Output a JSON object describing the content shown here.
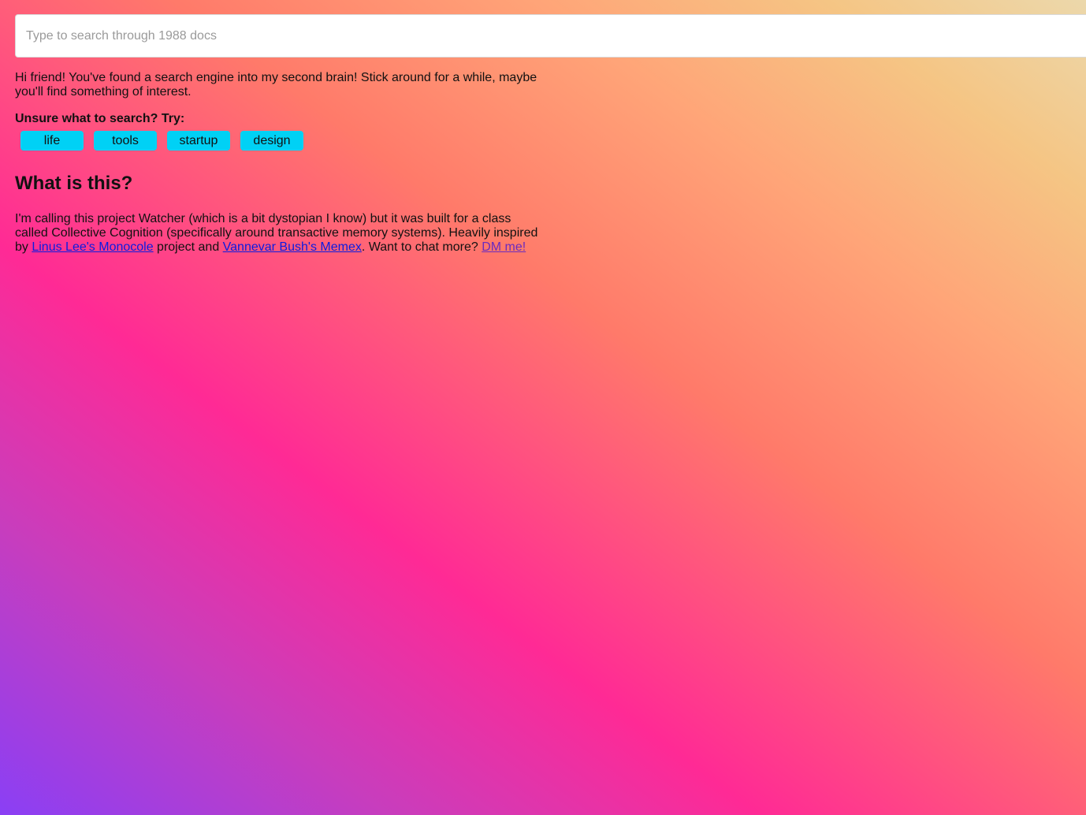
{
  "search": {
    "placeholder": "Type to search through 1988 docs",
    "value": ""
  },
  "intro": {
    "text": "Hi friend! You've found a search engine into my second brain! Stick around for a while, maybe you'll find something of interest."
  },
  "suggestions": {
    "label": "Unsure what to search? Try:",
    "chips": [
      "life",
      "tools",
      "startup",
      "design"
    ]
  },
  "about": {
    "title": "What is this?",
    "text_1": "I'm calling this project Watcher (which is a bit dystopian I know) but it was built for a class called Collective Cognition (specifically around transactive memory systems). Heavily inspired by ",
    "link_1": "Linus Lee's Monocole",
    "text_2": " project and ",
    "link_2": "Vannevar Bush's Memex",
    "text_3": ". Want to chat more? ",
    "link_3": "DM me!"
  },
  "colors": {
    "chip_background": "#00d1f5",
    "link": "#0a1ce0",
    "visited_link": "#6a2bbf",
    "gradient": [
      "#8a3ff5",
      "#ff2a95",
      "#ff7a6a",
      "#ffa578",
      "#ecd8ab"
    ]
  }
}
